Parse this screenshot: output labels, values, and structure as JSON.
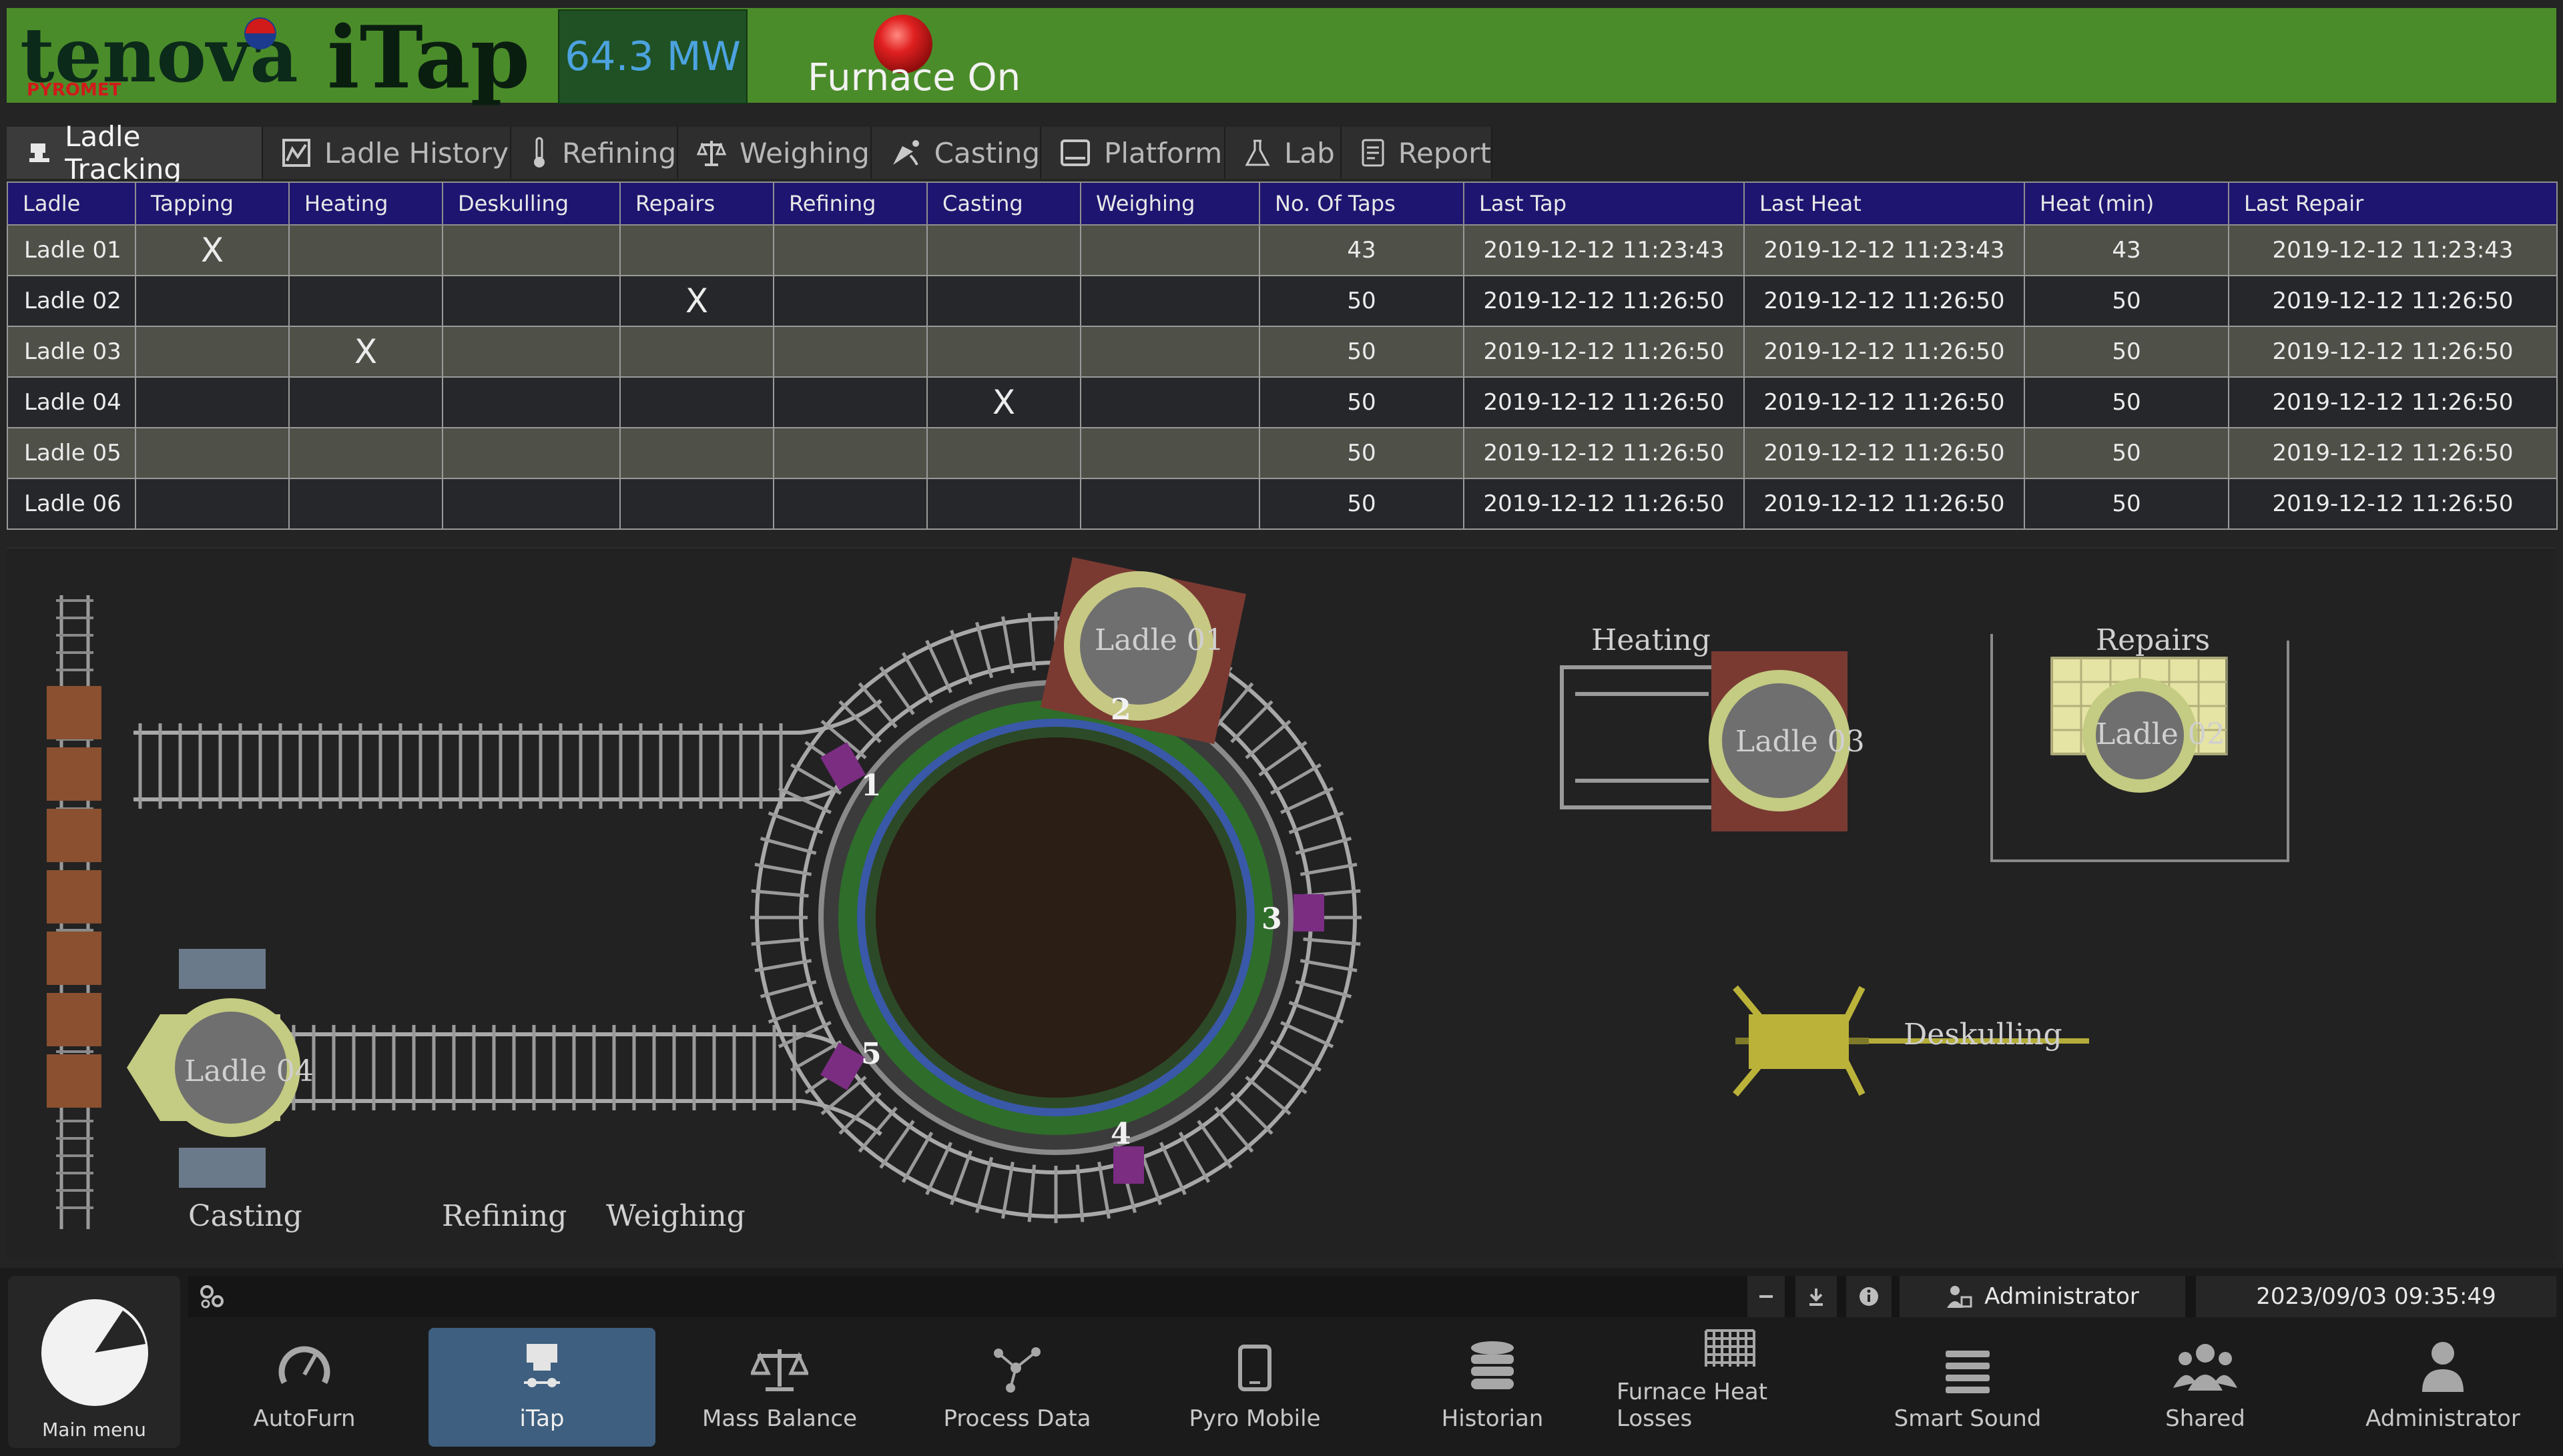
{
  "header": {
    "brand": "tenova",
    "brand_sub": "PYROMET",
    "app_title": "iTap",
    "power": "64.3 MW",
    "furnace_status": "Furnace On",
    "status_light_color": "#d61f1f",
    "accent_green": "#4b8c2a"
  },
  "tabs": [
    {
      "label": "Ladle Tracking",
      "icon": "ladle-icon",
      "active": true
    },
    {
      "label": "Ladle History",
      "icon": "chart-icon"
    },
    {
      "label": "Refining",
      "icon": "thermometer-icon"
    },
    {
      "label": "Weighing",
      "icon": "scale-icon"
    },
    {
      "label": "Casting",
      "icon": "pour-icon"
    },
    {
      "label": "Platform",
      "icon": "screen-icon"
    },
    {
      "label": "Lab",
      "icon": "flask-icon"
    },
    {
      "label": "Report",
      "icon": "report-icon"
    }
  ],
  "table": {
    "columns": [
      "Ladle",
      "Tapping",
      "Heating",
      "Deskulling",
      "Repairs",
      "Refining",
      "Casting",
      "Weighing",
      "No. Of Taps",
      "Last Tap",
      "Last Heat",
      "Heat (min)",
      "Last Repair"
    ],
    "rows": [
      [
        "Ladle 01",
        "X",
        "",
        "",
        "",
        "",
        "",
        "",
        "43",
        "2019-12-12 11:23:43",
        "2019-12-12 11:23:43",
        "43",
        "2019-12-12 11:23:43"
      ],
      [
        "Ladle 02",
        "",
        "",
        "",
        "X",
        "",
        "",
        "",
        "50",
        "2019-12-12 11:26:50",
        "2019-12-12 11:26:50",
        "50",
        "2019-12-12 11:26:50"
      ],
      [
        "Ladle 03",
        "",
        "X",
        "",
        "",
        "",
        "",
        "",
        "50",
        "2019-12-12 11:26:50",
        "2019-12-12 11:26:50",
        "50",
        "2019-12-12 11:26:50"
      ],
      [
        "Ladle 04",
        "",
        "",
        "",
        "",
        "",
        "X",
        "",
        "50",
        "2019-12-12 11:26:50",
        "2019-12-12 11:26:50",
        "50",
        "2019-12-12 11:26:50"
      ],
      [
        "Ladle 05",
        "",
        "",
        "",
        "",
        "",
        "",
        "",
        "50",
        "2019-12-12 11:26:50",
        "2019-12-12 11:26:50",
        "50",
        "2019-12-12 11:26:50"
      ],
      [
        "Ladle 06",
        "",
        "",
        "",
        "",
        "",
        "",
        "",
        "50",
        "2019-12-12 11:26:50",
        "2019-12-12 11:26:50",
        "50",
        "2019-12-12 11:26:50"
      ]
    ]
  },
  "diagram": {
    "station_labels": {
      "heating": "Heating",
      "repairs": "Repairs",
      "deskulling": "Deskulling",
      "casting": "Casting",
      "refining": "Refining",
      "weighing": "Weighing"
    },
    "ladles": {
      "ladle01": "Ladle 01",
      "ladle02": "Ladle 02",
      "ladle03": "Ladle 03",
      "ladle04": "Ladle 04"
    },
    "tap_holes": [
      "1",
      "2",
      "3",
      "4",
      "5"
    ]
  },
  "statusbar": {
    "user": "Administrator",
    "datetime": "2023/09/03 09:35:49"
  },
  "main_menu_label": "Main menu",
  "nav": [
    {
      "label": "AutoFurn",
      "icon": "gauge-icon"
    },
    {
      "label": "iTap",
      "icon": "itap-icon",
      "active": true
    },
    {
      "label": "Mass Balance",
      "icon": "balance-icon"
    },
    {
      "label": "Process Data",
      "icon": "network-icon"
    },
    {
      "label": "Pyro Mobile",
      "icon": "tablet-icon"
    },
    {
      "label": "Historian",
      "icon": "database-icon"
    },
    {
      "label": "Furnace Heat Losses",
      "icon": "grid-icon"
    },
    {
      "label": "Smart Sound",
      "icon": "lines-icon"
    },
    {
      "label": "Shared",
      "icon": "group-icon"
    },
    {
      "label": "Administrator",
      "icon": "user-icon"
    }
  ]
}
